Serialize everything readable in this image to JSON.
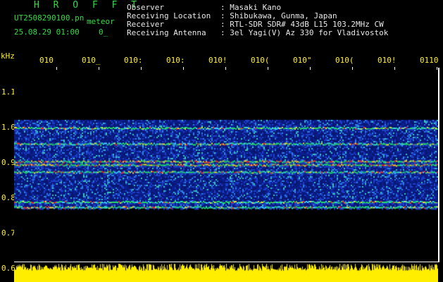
{
  "header": {
    "brand": "H R O F F T",
    "filename": "UT2508290100.pn",
    "mode": "meteor",
    "datetime": "25.08.29 01:00",
    "count": "0_"
  },
  "meta": [
    {
      "label": "Observer",
      "value": ": Masaki Kano"
    },
    {
      "label": "Receiving Location",
      "value": ": Shibukawa, Gunma, Japan"
    },
    {
      "label": "Receiver",
      "value": ": RTL-SDR SDR# 43dB L15 103.2MHz CW"
    },
    {
      "label": "Receiving Antenna",
      "value": ": 3el Yagi(V) Az 330 for Vladivostok"
    }
  ],
  "axis": {
    "unit": "kHz",
    "y_ticks": [
      "1.1",
      "1.0",
      "0.9",
      "0.8",
      "0.7",
      "0.6"
    ],
    "x_ticks": [
      "010",
      "010_",
      "010:",
      "010:",
      "010!",
      "010(",
      "010\"",
      "010(",
      "010!",
      "0110"
    ]
  },
  "colors": {
    "text_primary": "#33dd44",
    "text_meta": "#e8e8e8",
    "axis": "#ffee33",
    "background": "#000000",
    "noise_base": "#0b1e8f",
    "signal_hot": "#ff2a2a",
    "signal_warm": "#22dd66",
    "level_bar": "#ffee00"
  },
  "spectrum": {
    "freq_range_khz": [
      0.6,
      1.15
    ],
    "band_khz": [
      0.77,
      1.02
    ],
    "lines_khz": [
      1.0,
      0.955,
      0.905,
      0.895,
      0.875,
      0.79,
      0.775
    ]
  }
}
